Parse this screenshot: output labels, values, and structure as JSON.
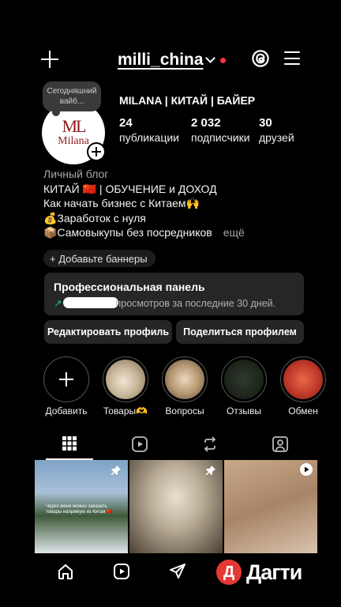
{
  "header": {
    "username": "milli_china"
  },
  "profile": {
    "note": "Сегодняшний вайб...",
    "avatar_monogram": "ML",
    "avatar_name": "Milana",
    "full_name": "MILANA | КИТАЙ | БАЙЕР",
    "stats": [
      {
        "value": "24",
        "label": "публикации"
      },
      {
        "value": "2 032",
        "label": "подписчики"
      },
      {
        "value": "30",
        "label": "друзей"
      }
    ]
  },
  "bio": {
    "category": "Личный блог",
    "lines": [
      "КИТАЙ 🇨🇳 | ОБУЧЕНИЕ и ДОХОД",
      "Как начать бизнес с Китаем🙌",
      "💰Заработок с нуля",
      "📦Самовыкупы без посредников"
    ],
    "more": "ещё"
  },
  "banner_pill": "+ Добавьте баннеры",
  "pro_panel": {
    "title": "Профессиональная панель",
    "subtitle": "просмотров за последние 30 дней.",
    "accent": "#2cbd6b"
  },
  "buttons": {
    "edit": "Редактировать профиль",
    "share": "Поделиться профилем"
  },
  "highlights": [
    {
      "label": "Добавить"
    },
    {
      "label": "Товары🫶"
    },
    {
      "label": "Вопросы"
    },
    {
      "label": "Отзывы"
    },
    {
      "label": "Обмен"
    }
  ],
  "grid": {
    "post1_caption": "Через меня можно заказать товары напрямую из Китая 🇨🇳"
  },
  "watermark": {
    "logo": "Д",
    "text": "Дагти"
  },
  "colors": {
    "background": "#000000",
    "surface": "#262626",
    "notification": "#ff3040"
  }
}
